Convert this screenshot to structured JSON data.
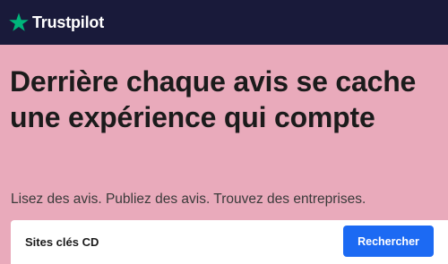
{
  "header": {
    "logo_text": "Trustpilot",
    "logo_icon": "star-icon",
    "background_color": "#191a3a",
    "star_color": "#00b67a"
  },
  "hero": {
    "headline": "Derrière chaque avis se cache une expérience qui compte",
    "subline": "Lisez des avis. Publiez des avis. Trouvez des entreprises.",
    "background_color": "#e9aabb"
  },
  "search": {
    "placeholder": "Sites clés CD",
    "value": "",
    "button_label": "Rechercher",
    "button_color": "#1c6af3"
  }
}
